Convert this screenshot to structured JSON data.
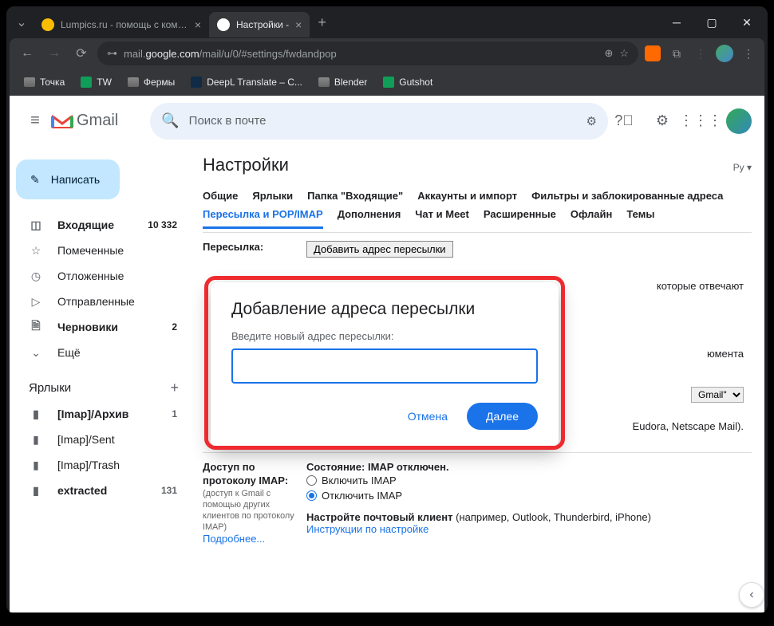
{
  "browser": {
    "tabs": [
      {
        "title": "Lumpics.ru - помощь с компью",
        "favicon": "orange"
      },
      {
        "title": "Настройки -",
        "favicon": "gmail"
      }
    ],
    "url_prefix": "mail.",
    "url_domain": "google.com",
    "url_path": "/mail/u/0/#settings/fwdandpop",
    "bookmarks": [
      {
        "label": "Точка",
        "type": "folder"
      },
      {
        "label": "TW",
        "type": "sheet"
      },
      {
        "label": "Фермы",
        "type": "folder"
      },
      {
        "label": "DeepL Translate – C...",
        "type": "deepl"
      },
      {
        "label": "Blender",
        "type": "folder"
      },
      {
        "label": "Gutshot",
        "type": "sheet"
      }
    ]
  },
  "gmail": {
    "brand": "Gmail",
    "search_placeholder": "Поиск в почте",
    "compose": "Написать",
    "nav": [
      {
        "icon": "inbox",
        "label": "Входящие",
        "count": "10 332",
        "active": true
      },
      {
        "icon": "star",
        "label": "Помеченные"
      },
      {
        "icon": "clock",
        "label": "Отложенные"
      },
      {
        "icon": "send",
        "label": "Отправленные"
      },
      {
        "icon": "draft",
        "label": "Черновики",
        "count": "2"
      },
      {
        "icon": "more",
        "label": "Ещё"
      }
    ],
    "labels_header": "Ярлыки",
    "labels": [
      {
        "label": "[Imap]/Архив",
        "count": "1",
        "bold": true
      },
      {
        "label": "[Imap]/Sent"
      },
      {
        "label": "[Imap]/Trash"
      },
      {
        "label": "extracted",
        "count": "131",
        "bold": true
      }
    ]
  },
  "settings": {
    "title": "Настройки",
    "lang": "Ру",
    "tabs_row1": [
      "Общие",
      "Ярлыки",
      "Папка \"Входящие\"",
      "Аккаунты и импорт",
      "Фильтры и заблокированные адреса"
    ],
    "tabs_row2": [
      "Пересылка и POP/IMAP",
      "Дополнения",
      "Чат и Meet",
      "Расширенные",
      "Офлайн",
      "Темы"
    ],
    "active_tab": "Пересылка и POP/IMAP",
    "fwd_label": "Пересылка:",
    "fwd_add_btn": "Добавить адрес пересылки",
    "fwd_fragment1": "которые отвечают",
    "pop_fragment_dropdown": "Gmail\"",
    "pop_fragment_tail": "Eudora, Netscape Mail).",
    "pop_instructions": "Инструкции по настройке",
    "fragment_moment": "юмента",
    "imap_label": "Доступ по протоколу IMAP:",
    "imap_sub": "(доступ к Gmail с помощью других клиентов по протоколу IMAP)",
    "imap_more": "Подробнее...",
    "imap_state_label": "Состояние:",
    "imap_state_value": "IMAP отключен.",
    "imap_opt_on": "Включить IMAP",
    "imap_opt_off": "Отключить IMAP",
    "imap_client_label": "Настройте почтовый клиент",
    "imap_client_tail": "(например, Outlook, Thunderbird, iPhone)",
    "imap_instructions": "Инструкции по настройке"
  },
  "dialog": {
    "title": "Добавление адреса пересылки",
    "prompt": "Введите новый адрес пересылки:",
    "input_value": "",
    "cancel": "Отмена",
    "next": "Далее"
  }
}
